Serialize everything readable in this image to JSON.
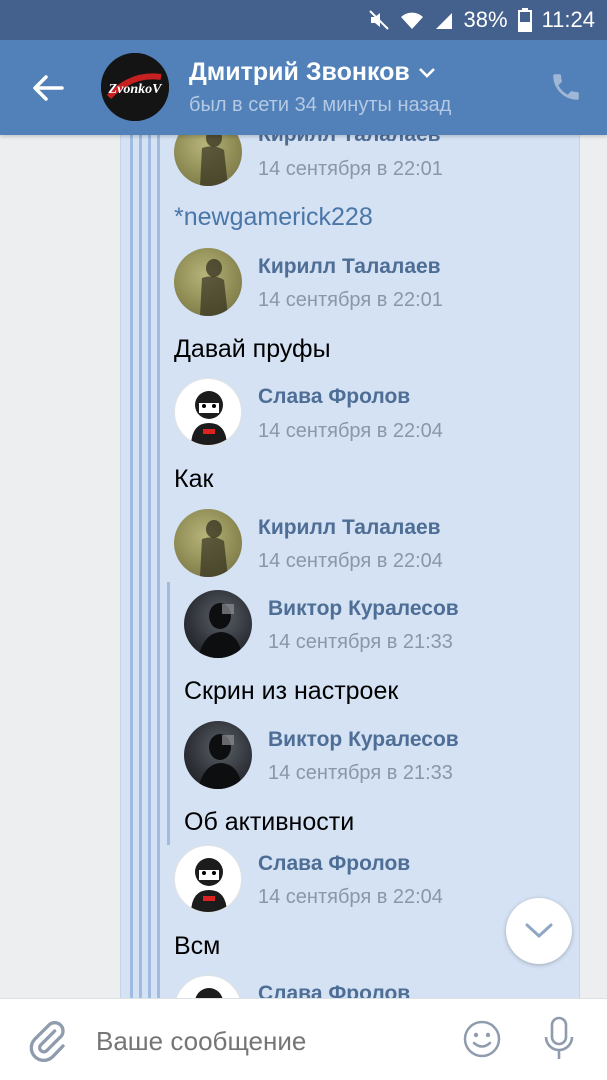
{
  "status_bar": {
    "battery": "38%",
    "time": "11:24",
    "icons": [
      "mute-icon",
      "wifi-icon",
      "signal-icon",
      "battery-icon"
    ]
  },
  "header": {
    "name": "Дмитрий Звонков",
    "status": "был в сети 34 минуты назад",
    "avatar_text": "ZvonkoV"
  },
  "messages": {
    "m0": {
      "sender": "Кирилл Талалаев",
      "date": "14 сентября в 22:01"
    },
    "t0": "*newgamerick228",
    "m1": {
      "sender": "Кирилл Талалаев",
      "date": "14 сентября в 22:01"
    },
    "t1": "Давай пруфы",
    "m2": {
      "sender": "Слава Фролов",
      "date": "14 сентября в 22:04"
    },
    "t2": "Как",
    "m3": {
      "sender": "Кирилл Талалаев",
      "date": "14 сентября в 22:04"
    },
    "m4": {
      "sender": "Виктор Куралесов",
      "date": "14 сентября в 21:33"
    },
    "t4": "Скрин из настроек",
    "m5": {
      "sender": "Виктор Куралесов",
      "date": "14 сентября в 21:33"
    },
    "t5": "Об активности",
    "m6": {
      "sender": "Слава Фролов",
      "date": "14 сентября в 22:04"
    },
    "t6": "Всм",
    "m7": {
      "sender": "Слава Фролов"
    }
  },
  "composer": {
    "placeholder": "Ваше сообщение"
  },
  "colors": {
    "header": "#5181b8",
    "status_bar": "#44608c",
    "bubble": "#d4e2f4",
    "link": "#4a76a8",
    "sender": "#4e6e96"
  }
}
